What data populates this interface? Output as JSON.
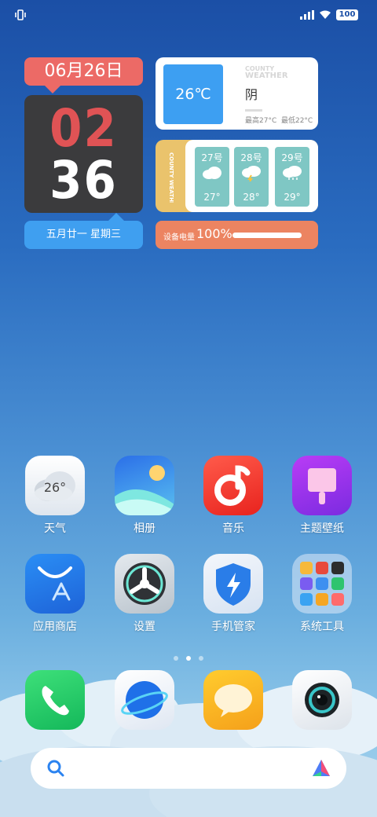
{
  "status_bar": {
    "battery": "100"
  },
  "clock_widget": {
    "date": "06月26日",
    "hour": "02",
    "minute": "36",
    "lunar": "五月廿一  星期三"
  },
  "weather_widget": {
    "temperature": "26℃",
    "condition": "阴",
    "tag_line1": "COUNTY",
    "tag_line2": "WEATHER",
    "high": "最高27°C",
    "low": "最低22°C"
  },
  "forecast_widget": {
    "tag": "COUNTY WEATHER",
    "days": [
      {
        "day": "27号",
        "temp": "27°",
        "icon": "cloud-icon"
      },
      {
        "day": "28号",
        "temp": "28°",
        "icon": "thunderstorm-icon"
      },
      {
        "day": "29号",
        "temp": "29°",
        "icon": "rain-cloud-icon"
      }
    ]
  },
  "battery_widget": {
    "label": "设备电量",
    "percent": "100%",
    "level": 1.0
  },
  "apps": [
    {
      "label": "天气",
      "icon": "weather-icon",
      "badge": "26°"
    },
    {
      "label": "相册",
      "icon": "gallery-icon"
    },
    {
      "label": "音乐",
      "icon": "music-icon"
    },
    {
      "label": "主题壁纸",
      "icon": "theme-icon"
    },
    {
      "label": "应用商店",
      "icon": "app-store-icon"
    },
    {
      "label": "设置",
      "icon": "settings-icon"
    },
    {
      "label": "手机管家",
      "icon": "security-icon"
    },
    {
      "label": "系统工具",
      "icon": "system-tools-folder-icon"
    }
  ],
  "dock": [
    {
      "icon": "phone-icon"
    },
    {
      "icon": "browser-icon"
    },
    {
      "icon": "messages-icon"
    },
    {
      "icon": "camera-icon"
    }
  ],
  "search_bar": {
    "icon": "search-icon",
    "assistant_icon": "assistant-icon"
  },
  "colors": {
    "clock_hour": "#e05355",
    "date_bubble": "#ec6a66",
    "lunar_bubble": "#3f9ff0",
    "battery_widget": "#ec8461",
    "forecast_day": "#7fc7c4"
  }
}
